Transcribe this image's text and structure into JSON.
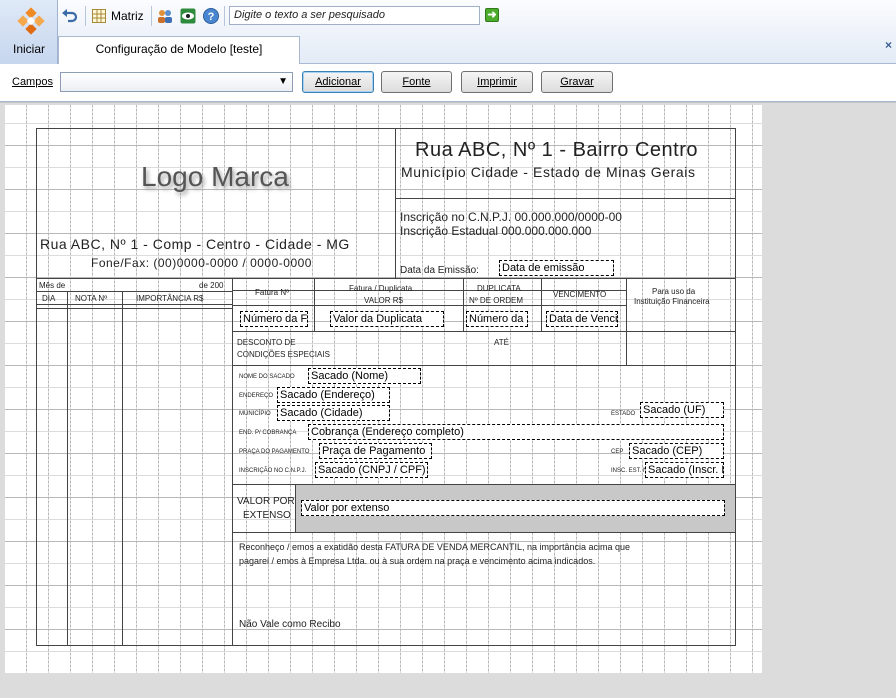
{
  "toolbar": {
    "start_label": "Iniciar",
    "matriz_label": "Matriz",
    "search_placeholder": "Digite o texto a ser pesquisado",
    "tab_label": "Configuração de Modelo [teste]",
    "close_symbol": "×"
  },
  "options": {
    "campos_label": "Campos",
    "campos_value": "",
    "adicionar_label": "Adicionar",
    "fonte_label": "Fonte",
    "imprimir_label": "Imprimir",
    "gravar_label": "Gravar"
  },
  "form": {
    "logo_text": "Logo Marca",
    "left_address": "Rua ABC, Nº 1 - Comp - Centro - Cidade - MG",
    "left_phone": "Fone/Fax: (00)0000-0000 / 0000-0000",
    "header_address": "Rua ABC, Nº 1 - Bairro Centro",
    "header_city": "Município Cidade - Estado de Minas Gerais",
    "cnpj_line": "Inscrição no C.N.P.J. 00.000.000/0000-00",
    "ie_line": "Inscrição Estadual 000.000.000.000",
    "emissao_label": "Data da Emissão:",
    "emissao_field": "Data de emissão",
    "mes_label": "Mês de",
    "ano_label": "de 200",
    "col_dia": "DIA",
    "col_nota": "NOTA Nº",
    "col_importancia": "IMPORTÂNCIA R$",
    "fatura_no": "Fatura Nº",
    "fatura_duplicata": "Fatura / Duplicata",
    "valor_rs": "VALOR R$",
    "duplicata": "DUPLICATA",
    "no_ordem": "Nº DE ORDEM",
    "vencimento": "VENCIMENTO",
    "uso_instituicao_1": "Para uso da",
    "uso_instituicao_2": "Instituição Financeira",
    "field_numero_fatura": "Número da Fatura",
    "field_valor_duplicata": "Valor da Duplicata",
    "field_numero_duplicata": "Número da Duplicata",
    "field_vencimento": "Data de Vencimento",
    "desconto_1": "DESCONTO DE",
    "desconto_2": "CONDIÇÕES ESPECIAIS",
    "ate": "ATÉ",
    "lbl_nome": "NOME DO SACADO",
    "lbl_endereco": "ENDEREÇO",
    "lbl_municipio": "MUNICÍPIO",
    "lbl_estado": "ESTADO",
    "lbl_cobranca": "END. P/ COBRANÇA",
    "lbl_praca": "PRAÇA DO PAGAMENTO",
    "lbl_cep": "CEP",
    "lbl_inscricao": "INSCRIÇÃO NO C.N.P.J.",
    "lbl_insc_est": "INSC. EST. Nº",
    "f_nome": "Sacado (Nome)",
    "f_endereco": "Sacado (Endereço)",
    "f_cidade": "Sacado (Cidade)",
    "f_uf": "Sacado (UF)",
    "f_cobranca": "Cobrança (Endereço completo)",
    "f_praca": "Praça de Pagamento",
    "f_cep": "Sacado (CEP)",
    "f_cnpj": "Sacado (CNPJ / CPF)",
    "f_inscr": "Sacado (Inscr. Estadual)",
    "valor_extenso_1": "VALOR POR",
    "valor_extenso_2": "EXTENSO",
    "f_valor_extenso": "Valor por extenso",
    "reconheco_1": "Reconheço / emos a exatidão desta FATURA DE VENDA MERCANTIL, na importância acima que",
    "reconheco_2": "pagarei / emos à  Empresa Ltda.  ou à sua ordem na praça e vencimento acima indicados.",
    "nao_vale": "Não Vale como Recibo"
  }
}
